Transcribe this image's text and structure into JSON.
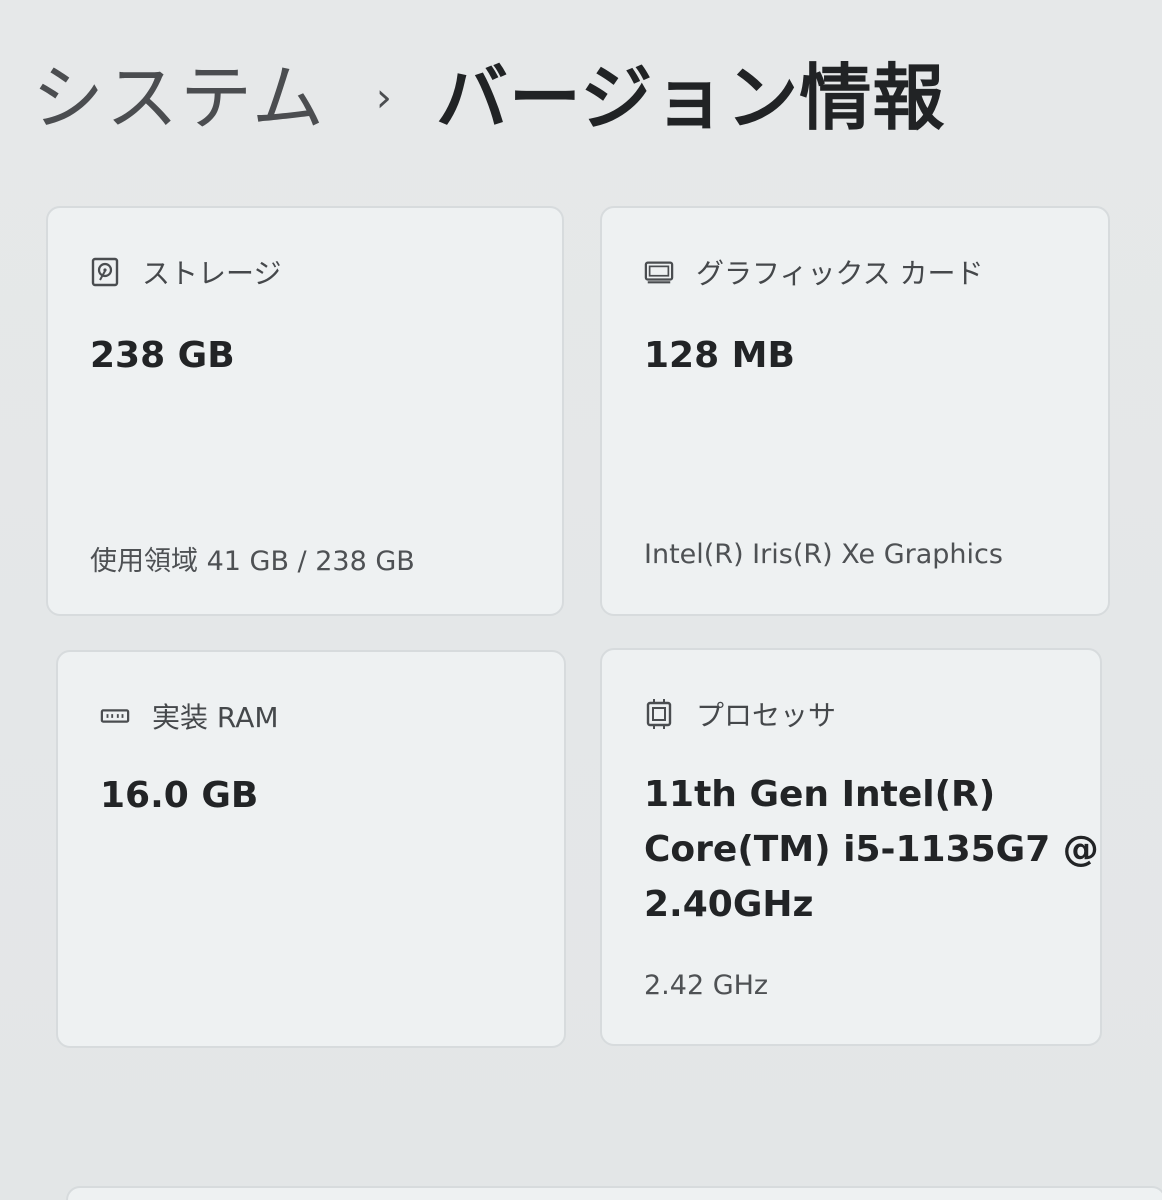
{
  "breadcrumb": {
    "parent": "システム",
    "separator": "›",
    "current": "バージョン情報"
  },
  "cards": {
    "storage": {
      "icon": "storage-icon",
      "title": "ストレージ",
      "value": "238 GB",
      "detail": "使用領域 41 GB / 238 GB"
    },
    "graphics": {
      "icon": "graphics-card-icon",
      "title": "グラフィックス カード",
      "value": "128 MB",
      "detail": "Intel(R) Iris(R) Xe Graphics"
    },
    "ram": {
      "icon": "ram-icon",
      "title": "実装 RAM",
      "value": "16.0 GB"
    },
    "processor": {
      "icon": "processor-icon",
      "title": "プロセッサ",
      "value_lines": [
        "11th Gen Intel(R)",
        "Core(TM) i5-1135G7 @",
        "2.40GHz"
      ],
      "detail": "2.42 GHz"
    }
  }
}
